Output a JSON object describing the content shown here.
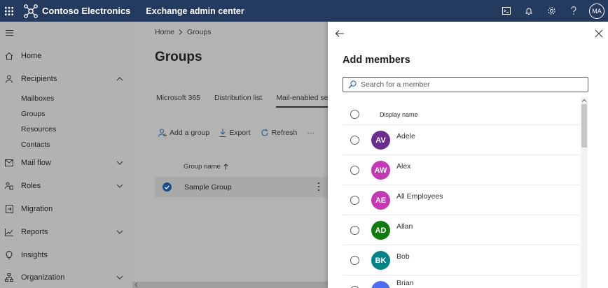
{
  "topbar": {
    "brand": "Contoso Electronics",
    "app_title": "Exchange admin center",
    "avatar_initials": "MA",
    "icons": [
      "waffle-icon",
      "terminal-icon",
      "bell-icon",
      "gear-icon",
      "help-icon"
    ]
  },
  "nav": {
    "items": [
      {
        "label": "Home",
        "icon": "home-icon"
      },
      {
        "label": "Recipients",
        "icon": "person-icon",
        "expanded": true
      },
      {
        "label": "Mail flow",
        "icon": "mail-icon"
      },
      {
        "label": "Roles",
        "icon": "roles-icon"
      },
      {
        "label": "Migration",
        "icon": "migration-icon"
      },
      {
        "label": "Reports",
        "icon": "reports-icon"
      },
      {
        "label": "Insights",
        "icon": "bulb-icon"
      },
      {
        "label": "Organization",
        "icon": "org-icon"
      }
    ],
    "recipients_sub": [
      "Mailboxes",
      "Groups",
      "Resources",
      "Contacts"
    ]
  },
  "main": {
    "breadcrumb": [
      "Home",
      "Groups"
    ],
    "title": "Groups",
    "tabs": [
      "Microsoft 365",
      "Distribution list",
      "Mail-enabled security"
    ],
    "commands": {
      "add": "Add a group",
      "export": "Export",
      "refresh": "Refresh",
      "more": "···"
    },
    "column_header": "Group name",
    "selected_row": "Sample Group"
  },
  "panel": {
    "title": "Add members",
    "search_placeholder": "Search for a member",
    "column_header": "Display name",
    "members": [
      {
        "initials": "AV",
        "name": "Adele",
        "color": "#6b2e8e"
      },
      {
        "initials": "AW",
        "name": "Alex",
        "color": "#c239b3"
      },
      {
        "initials": "AE",
        "name": "All Employees",
        "color": "#c239b3"
      },
      {
        "initials": "AD",
        "name": "Allan",
        "color": "#107c10"
      },
      {
        "initials": "BK",
        "name": "Bob",
        "color": "#038387"
      },
      {
        "initials": "",
        "name": "Brian",
        "color": "#4f6bed"
      }
    ]
  }
}
